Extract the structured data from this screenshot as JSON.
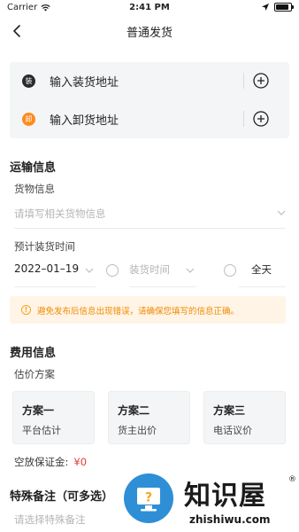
{
  "status_bar": {
    "carrier": "Carrier",
    "time": "2:41 PM"
  },
  "header": {
    "title": "普通发货"
  },
  "address": {
    "load": {
      "badge": "装",
      "label": "输入装货地址"
    },
    "unload": {
      "badge": "卸",
      "label": "输入卸货地址"
    }
  },
  "transport": {
    "title": "运输信息",
    "cargo_label": "货物信息",
    "cargo_placeholder": "请填写相关货物信息",
    "time_label": "预计装货时间",
    "date_value": "2022–01–19",
    "time_placeholder": "装货时间",
    "allday_label": "全天"
  },
  "notice": {
    "icon": "!",
    "text": "避免发布后信息出现错误，请确保您填写的信息正确。"
  },
  "fees": {
    "title": "费用信息",
    "plan_label": "估价方案",
    "plans": [
      {
        "name": "方案一",
        "desc": "平台估计"
      },
      {
        "name": "方案二",
        "desc": "货主出价"
      },
      {
        "name": "方案三",
        "desc": "电话议价"
      }
    ],
    "deposit_label": "空放保证金:",
    "deposit_value": "¥0"
  },
  "remarks": {
    "title": "特殊备注（可多选）",
    "placeholder": "请选择特殊备注"
  },
  "watermark": {
    "cn": "知识屋",
    "reg": "®",
    "en": "zhishiwu.com",
    "logo_glyph": "?"
  },
  "colors": {
    "accent_orange": "#ff8a1d",
    "notice_text": "#f08a00",
    "notice_bg": "#fff4e5",
    "deposit_red": "#e53935",
    "watermark_blue": "#2e8fd6"
  }
}
